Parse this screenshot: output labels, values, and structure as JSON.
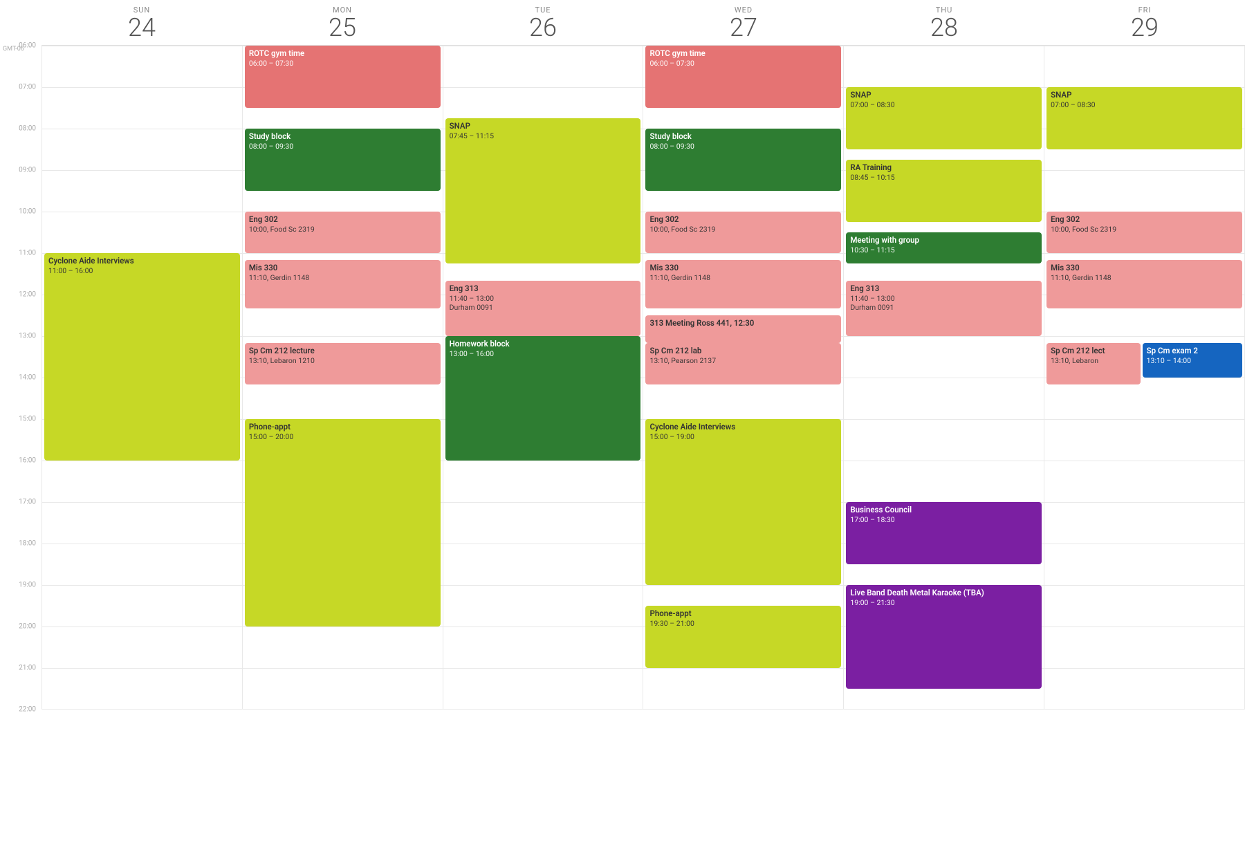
{
  "calendar": {
    "timezone": "GMT-06",
    "days": [
      {
        "name": "SUN",
        "num": "24"
      },
      {
        "name": "MON",
        "num": "25"
      },
      {
        "name": "TUE",
        "num": "26"
      },
      {
        "name": "WED",
        "num": "27"
      },
      {
        "name": "THU",
        "num": "28"
      },
      {
        "name": "FRI",
        "num": "29"
      }
    ],
    "hours": [
      "06:00",
      "07:00",
      "08:00",
      "09:00",
      "10:00",
      "11:00",
      "12:00",
      "13:00",
      "14:00",
      "15:00",
      "16:00",
      "17:00",
      "18:00",
      "19:00",
      "20:00",
      "21:00",
      "22:00"
    ],
    "events": [
      {
        "id": "rotc-mon",
        "day": 1,
        "title": "ROTC gym time",
        "time": "06:00 – 07:30",
        "location": "",
        "color": "color-red",
        "startHour": 6,
        "startMin": 0,
        "endHour": 7,
        "endMin": 30
      },
      {
        "id": "study-mon",
        "day": 1,
        "title": "Study block",
        "time": "08:00 – 09:30",
        "location": "",
        "color": "color-green",
        "startHour": 8,
        "startMin": 0,
        "endHour": 9,
        "endMin": 30
      },
      {
        "id": "eng302-mon",
        "day": 1,
        "title": "Eng 302",
        "time": "10:00, Food Sc 2319",
        "location": "",
        "color": "color-salmon",
        "startHour": 10,
        "startMin": 0,
        "endHour": 11,
        "endMin": 0
      },
      {
        "id": "mis330-mon",
        "day": 1,
        "title": "Mis 330",
        "time": "11:10, Gerdin 1148",
        "location": "",
        "color": "color-salmon",
        "startHour": 11,
        "startMin": 10,
        "endHour": 12,
        "endMin": 20
      },
      {
        "id": "spcm212-mon",
        "day": 1,
        "title": "Sp Cm 212 lecture",
        "time": "13:10, Lebaron 1210",
        "location": "",
        "color": "color-salmon",
        "startHour": 13,
        "startMin": 10,
        "endHour": 14,
        "endMin": 10
      },
      {
        "id": "phone-mon",
        "day": 1,
        "title": "Phone-appt",
        "time": "15:00 – 20:00",
        "location": "",
        "color": "color-lime",
        "startHour": 15,
        "startMin": 0,
        "endHour": 20,
        "endMin": 0
      },
      {
        "id": "snap-tue",
        "day": 2,
        "title": "SNAP",
        "time": "07:45 – 11:15",
        "location": "",
        "color": "color-lime",
        "startHour": 7,
        "startMin": 45,
        "endHour": 11,
        "endMin": 15
      },
      {
        "id": "eng313-tue",
        "day": 2,
        "title": "Eng 313",
        "time": "11:40 – 13:00",
        "location": "Durham 0091",
        "color": "color-salmon",
        "startHour": 11,
        "startMin": 40,
        "endHour": 13,
        "endMin": 0
      },
      {
        "id": "homework-tue",
        "day": 2,
        "title": "Homework block",
        "time": "13:00 – 16:00",
        "location": "",
        "color": "color-green",
        "startHour": 13,
        "startMin": 0,
        "endHour": 16,
        "endMin": 0
      },
      {
        "id": "rotc-wed",
        "day": 3,
        "title": "ROTC gym time",
        "time": "06:00 – 07:30",
        "location": "",
        "color": "color-red",
        "startHour": 6,
        "startMin": 0,
        "endHour": 7,
        "endMin": 30
      },
      {
        "id": "study-wed",
        "day": 3,
        "title": "Study block",
        "time": "08:00 – 09:30",
        "location": "",
        "color": "color-green",
        "startHour": 8,
        "startMin": 0,
        "endHour": 9,
        "endMin": 30
      },
      {
        "id": "eng302-wed",
        "day": 3,
        "title": "Eng 302",
        "time": "10:00, Food Sc 2319",
        "location": "",
        "color": "color-salmon",
        "startHour": 10,
        "startMin": 0,
        "endHour": 11,
        "endMin": 0
      },
      {
        "id": "mis330-wed",
        "day": 3,
        "title": "Mis 330",
        "time": "11:10, Gerdin 1148",
        "location": "",
        "color": "color-salmon",
        "startHour": 11,
        "startMin": 10,
        "endHour": 12,
        "endMin": 20
      },
      {
        "id": "meeting313-wed",
        "day": 3,
        "title": "313 Meeting Ross 441, 12:30",
        "time": "",
        "location": "",
        "color": "color-salmon",
        "startHour": 12,
        "startMin": 30,
        "endHour": 13,
        "endMin": 10
      },
      {
        "id": "spcm212lab-wed",
        "day": 3,
        "title": "Sp Cm 212 lab",
        "time": "13:10, Pearson 2137",
        "location": "",
        "color": "color-salmon",
        "startHour": 13,
        "startMin": 10,
        "endHour": 14,
        "endMin": 10
      },
      {
        "id": "cyclone-wed",
        "day": 3,
        "title": "Cyclone Aide Interviews",
        "time": "15:00 – 19:00",
        "location": "",
        "color": "color-lime",
        "startHour": 15,
        "startMin": 0,
        "endHour": 19,
        "endMin": 0
      },
      {
        "id": "phone-wed",
        "day": 3,
        "title": "Phone-appt",
        "time": "19:30 – 21:00",
        "location": "",
        "color": "color-lime",
        "startHour": 19,
        "startMin": 30,
        "endHour": 21,
        "endMin": 0
      },
      {
        "id": "snap-thu",
        "day": 4,
        "title": "SNAP",
        "time": "07:00 – 08:30",
        "location": "",
        "color": "color-lime",
        "startHour": 7,
        "startMin": 0,
        "endHour": 8,
        "endMin": 30
      },
      {
        "id": "ra-thu",
        "day": 4,
        "title": "RA Training",
        "time": "08:45 – 10:15",
        "location": "",
        "color": "color-lime",
        "startHour": 8,
        "startMin": 45,
        "endHour": 10,
        "endMin": 15
      },
      {
        "id": "meeting-thu",
        "day": 4,
        "title": "Meeting with group",
        "time": "10:30 – 11:15",
        "location": "",
        "color": "color-green",
        "startHour": 10,
        "startMin": 30,
        "endHour": 11,
        "endMin": 15
      },
      {
        "id": "eng313-thu",
        "day": 4,
        "title": "Eng 313",
        "time": "11:40 – 13:00",
        "location": "Durham 0091",
        "color": "color-salmon",
        "startHour": 11,
        "startMin": 40,
        "endHour": 13,
        "endMin": 0
      },
      {
        "id": "business-thu",
        "day": 4,
        "title": "Business Council",
        "time": "17:00 – 18:30",
        "location": "",
        "color": "color-purple",
        "startHour": 17,
        "startMin": 0,
        "endHour": 18,
        "endMin": 30
      },
      {
        "id": "liveband-thu",
        "day": 4,
        "title": "Live Band Death Metal Karaoke (TBA)",
        "time": "19:00 – 21:30",
        "location": "",
        "color": "color-purple",
        "startHour": 19,
        "startMin": 0,
        "endHour": 21,
        "endMin": 30
      },
      {
        "id": "snap-fri",
        "day": 5,
        "title": "SNAP",
        "time": "07:00 – 08:30",
        "location": "",
        "color": "color-lime",
        "startHour": 7,
        "startMin": 0,
        "endHour": 8,
        "endMin": 30
      },
      {
        "id": "eng302-fri",
        "day": 5,
        "title": "Eng 302",
        "time": "10:00, Food Sc 2319",
        "location": "",
        "color": "color-salmon",
        "startHour": 10,
        "startMin": 0,
        "endHour": 11,
        "endMin": 0
      },
      {
        "id": "mis330-fri",
        "day": 5,
        "title": "Mis 330",
        "time": "11:10, Gerdin 1148",
        "location": "",
        "color": "color-salmon",
        "startHour": 11,
        "startMin": 10,
        "endHour": 12,
        "endMin": 20
      },
      {
        "id": "spcm212lec-fri",
        "day": 5,
        "title": "Sp Cm 212 lect",
        "time": "13:10, Lebaron",
        "location": "",
        "color": "color-salmon",
        "startHour": 13,
        "startMin": 10,
        "endHour": 14,
        "endMin": 10,
        "partial": true
      },
      {
        "id": "spcmexam-fri",
        "day": 5,
        "title": "Sp Cm exam 2",
        "time": "13:10 – 14:00",
        "location": "",
        "color": "color-blue",
        "startHour": 13,
        "startMin": 10,
        "endHour": 14,
        "endMin": 0,
        "offset": true
      },
      {
        "id": "cyclone-sun",
        "day": 0,
        "title": "Cyclone Aide Interviews",
        "time": "11:00 – 16:00",
        "location": "",
        "color": "color-lime",
        "startHour": 11,
        "startMin": 0,
        "endHour": 16,
        "endMin": 0
      }
    ]
  }
}
